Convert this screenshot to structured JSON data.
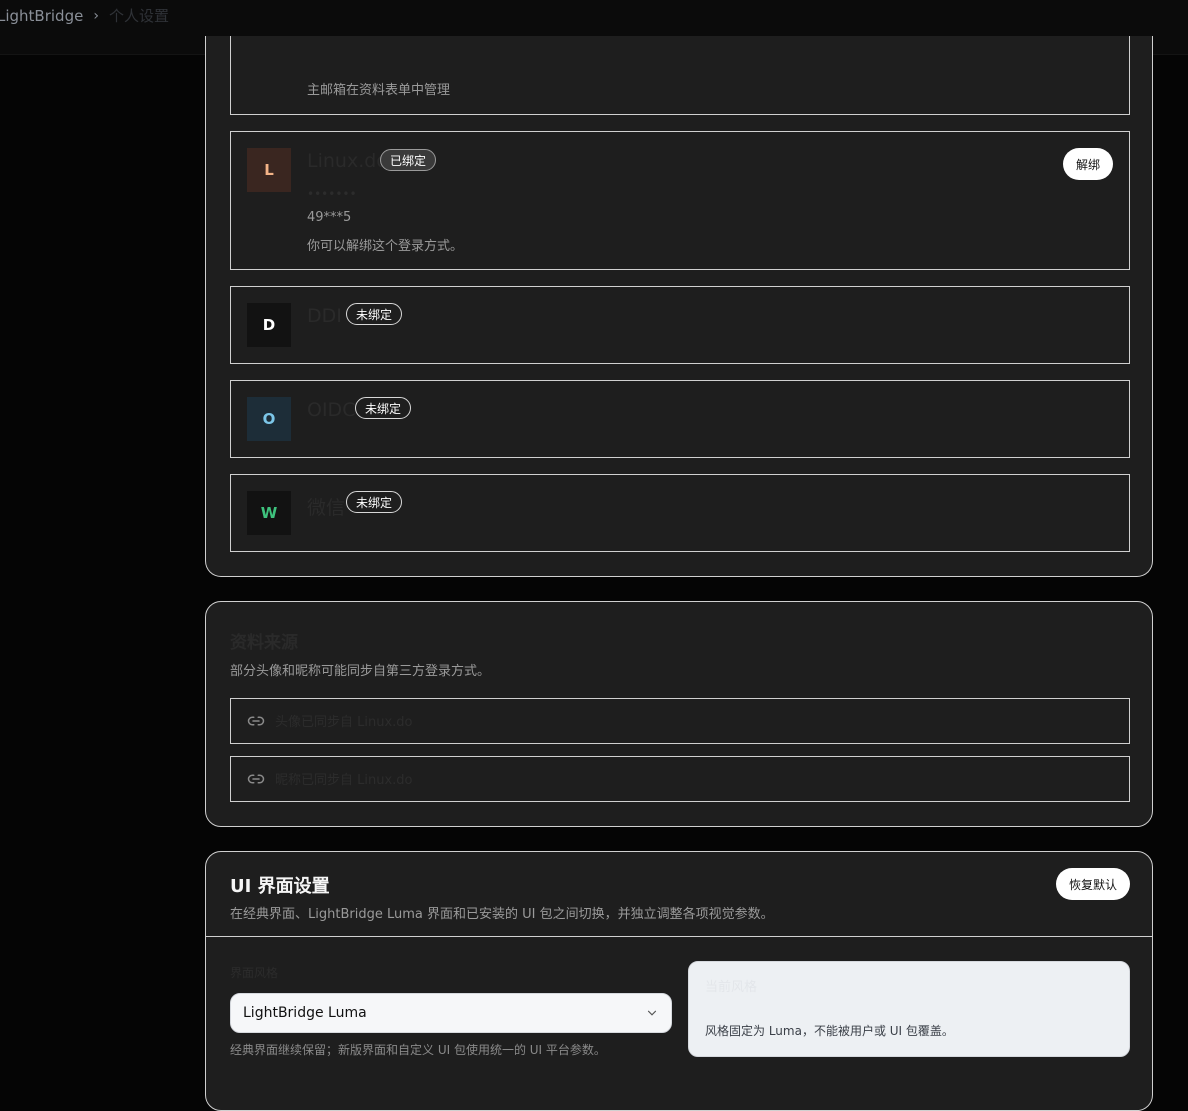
{
  "breadcrumb": {
    "app": "LightBridge",
    "separator": "›",
    "page": "个人设置"
  },
  "email_row": {
    "hint": "主邮箱在资料表单中管理"
  },
  "providers": [
    {
      "letter": "L",
      "name": "Linux.do",
      "status": "已绑定",
      "sub": "•••••••",
      "account": "49***5",
      "note": "你可以解绑这个登录方式。",
      "action": "解绑",
      "avatar_bg": "#3a2620",
      "avatar_fg": "#f3b387"
    },
    {
      "letter": "D",
      "name": "DDI",
      "status": "未绑定",
      "avatar_bg": "#121212",
      "avatar_fg": "#ffffff"
    },
    {
      "letter": "O",
      "name": "OIDC",
      "status": "未绑定",
      "avatar_bg": "#1d2d38",
      "avatar_fg": "#7cc6e8"
    },
    {
      "letter": "W",
      "name": "微信",
      "status": "未绑定",
      "avatar_bg": "#121212",
      "avatar_fg": "#3ec27d"
    }
  ],
  "source": {
    "title": "资料来源",
    "desc": "部分头像和昵称可能同步自第三方登录方式。",
    "links": [
      "头像已同步自 Linux.do",
      "昵称已同步自 Linux.do"
    ]
  },
  "ui_settings": {
    "title": "UI 界面设置",
    "desc": "在经典界面、LightBridge Luma 界面和已安装的 UI 包之间切换，并独立调整各项视觉参数。",
    "reset": "恢复默认",
    "field_label": "界面风格",
    "selected": "LightBridge Luma",
    "help": "经典界面继续保留；新版界面和自定义 UI 包使用统一的 UI 平台参数。",
    "preview_title": "当前风格",
    "preview_desc": "风格固定为 Luma，不能被用户或 UI 包覆盖。"
  }
}
